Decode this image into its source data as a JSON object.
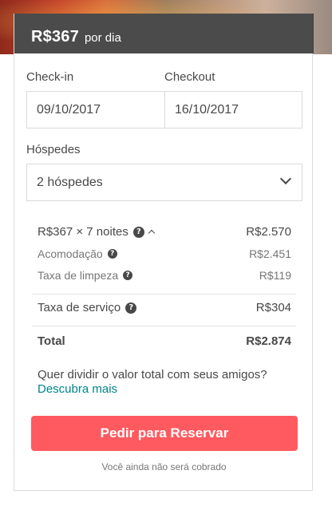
{
  "header": {
    "price": "R$367",
    "per_label": "por dia"
  },
  "dates": {
    "checkin_label": "Check-in",
    "checkout_label": "Checkout",
    "checkin_value": "09/10/2017",
    "checkout_value": "16/10/2017"
  },
  "guests": {
    "label": "Hóspedes",
    "selected": "2 hóspedes"
  },
  "breakdown": {
    "nights_label": "R$367 × 7 noites",
    "nights_value": "R$2.570",
    "lodging_label": "Acomodação",
    "lodging_value": "R$2.451",
    "cleaning_label": "Taxa de limpeza",
    "cleaning_value": "R$119",
    "service_label": "Taxa de serviço",
    "service_value": "R$304",
    "total_label": "Total",
    "total_value": "R$2.874"
  },
  "split": {
    "question": "Quer dividir o valor total com seus amigos?",
    "link": "Descubra mais"
  },
  "cta": {
    "button": "Pedir para Reservar",
    "note": "Você ainda não será cobrado"
  },
  "colors": {
    "accent": "#ff5a5f",
    "link": "#008489",
    "text": "#484848"
  },
  "icons": [
    "help-icon",
    "chevron-up-icon",
    "chevron-down-icon"
  ]
}
